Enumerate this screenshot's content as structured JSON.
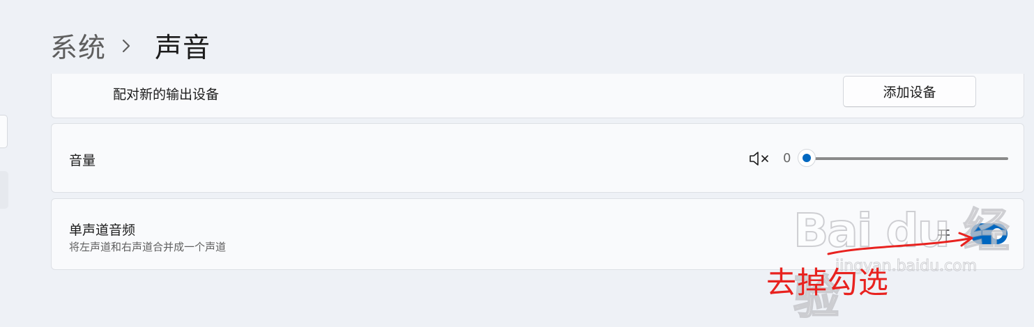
{
  "breadcrumb": {
    "parent": "系统",
    "current": "声音"
  },
  "pair_device": {
    "label": "配对新的输出设备",
    "button_label": "添加设备"
  },
  "volume": {
    "label": "音量",
    "value": "0",
    "level": 0,
    "icon": "speaker-muted-icon"
  },
  "mono_audio": {
    "title": "单声道音频",
    "description": "将左声道和右声道合并成一个声道",
    "toggle_text": "开",
    "enabled": true
  },
  "watermark": {
    "main": "Bai du 经验",
    "sub": "jingyan.baidu.com"
  },
  "annotation": {
    "text": "去掉勾选",
    "color": "#e8221f"
  },
  "colors": {
    "accent": "#0067c0",
    "background": "#eef1f6",
    "card": "#f9fafc"
  }
}
